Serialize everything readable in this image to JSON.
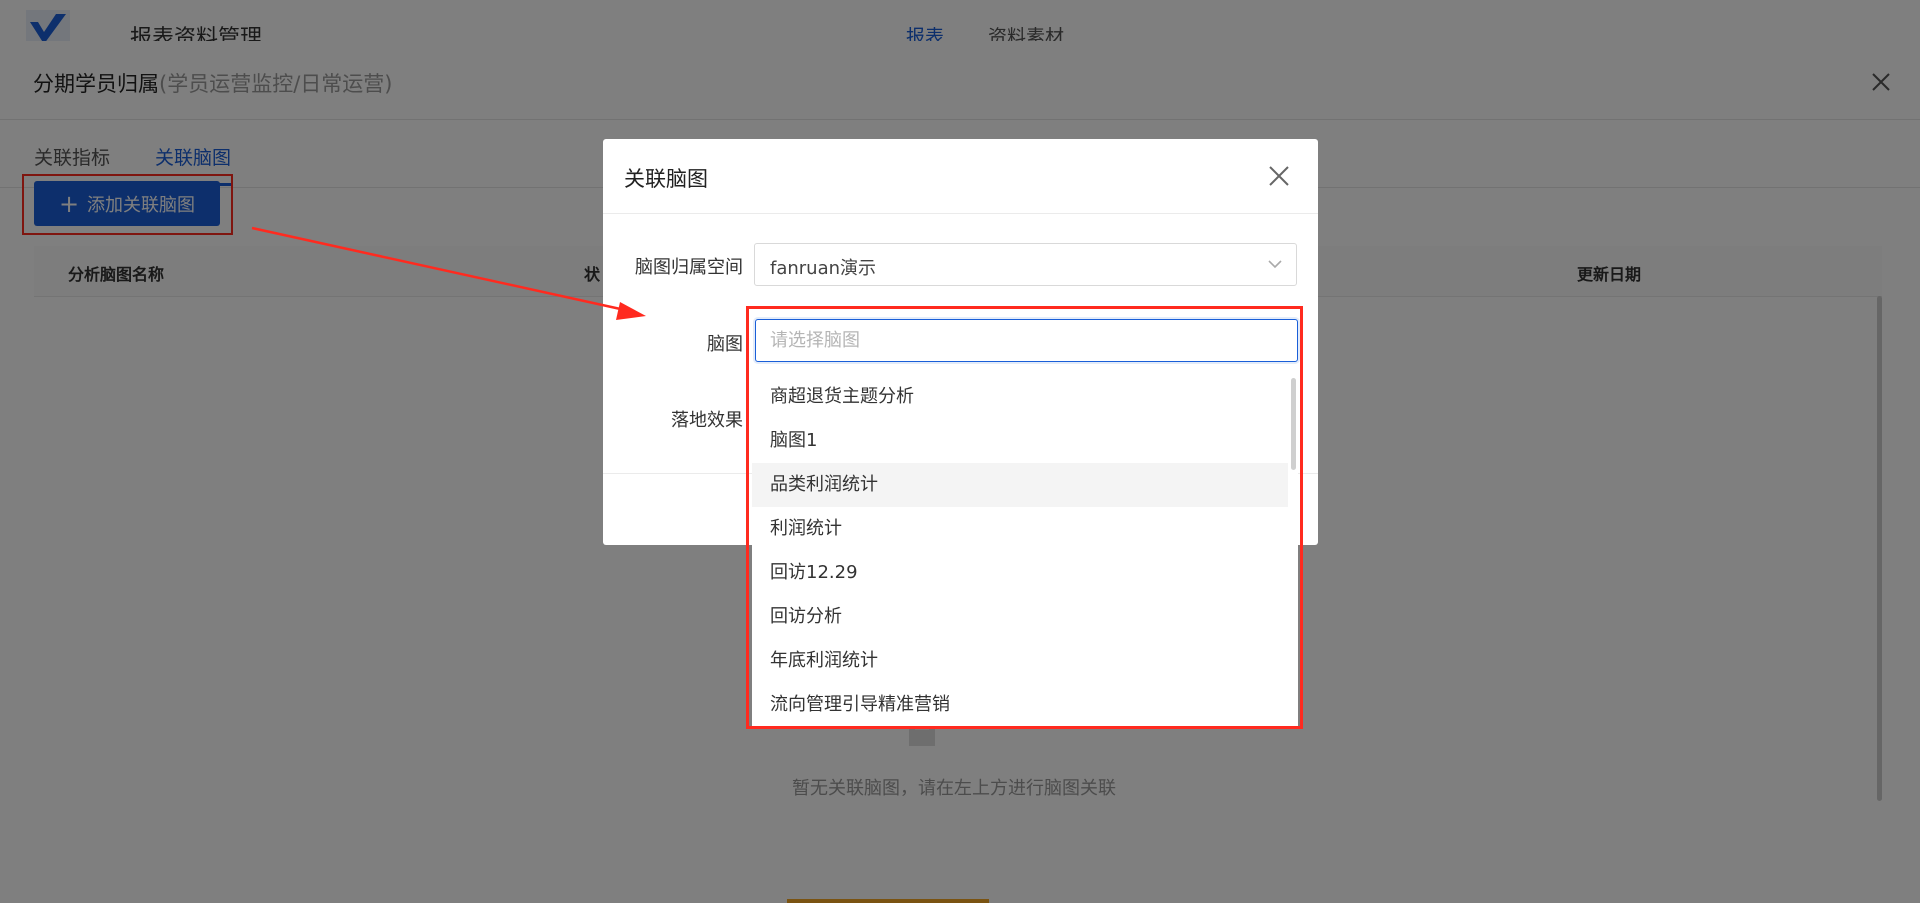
{
  "app": {
    "title": "报表资料管理",
    "nav": [
      "报表",
      "资料素材"
    ]
  },
  "drawer": {
    "title": "分期学员归属",
    "subtitle": "(学员运营监控/日常运营)",
    "tabs": [
      {
        "label": "关联指标",
        "active": false
      },
      {
        "label": "关联脑图",
        "active": true
      }
    ],
    "add_button_label": "添加关联脑图",
    "table_headers": [
      "分析脑图名称",
      "状",
      "更新日期"
    ],
    "empty_text": "暂无关联脑图，请在左上方进行脑图关联"
  },
  "modal": {
    "title": "关联脑图",
    "fields": {
      "space_label": "脑图归属空间",
      "space_value": "fanruan演示",
      "mindmap_label": "脑图",
      "mindmap_placeholder": "请选择脑图",
      "effect_label": "落地效果"
    },
    "dropdown_options": [
      "商超退货主题分析",
      "脑图1",
      "品类利润统计",
      "利润统计",
      "回访12.29",
      "回访分析",
      "年底利润统计",
      "流向管理引导精准营销"
    ],
    "hovered_option_index": 2
  },
  "colors": {
    "primary": "#1a5fd8",
    "highlight_red": "#ff2a1f",
    "mask": "rgba(0,0,0,0.5)"
  }
}
